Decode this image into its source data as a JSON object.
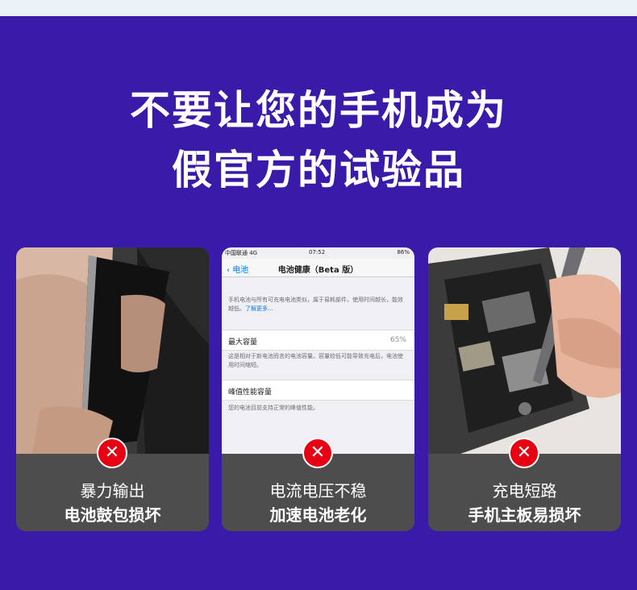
{
  "headline": {
    "line1": "不要让您的手机成为",
    "line2": "假官方的试验品"
  },
  "cards": [
    {
      "line1": "暴力输出",
      "line2": "电池鼓包损坏"
    },
    {
      "line1": "电流电压不稳",
      "line2": "加速电池老化"
    },
    {
      "line1": "充电短路",
      "line2": "手机主板易损坏"
    }
  ],
  "badge_symbol": "✕",
  "ios_screen": {
    "carrier": "中国联通 4G",
    "time": "07:52",
    "battery": "86%",
    "back_label": "电池",
    "nav_title": "电池健康（Beta 版）",
    "intro": "手机电池与所有可充电电池类似，属于易耗部件，使用时间越长，能效越低。",
    "learn_more": "了解更多...",
    "max_capacity_label": "最大容量",
    "max_capacity_value": "65%",
    "max_capacity_note": "这是相对于新电池而言的电池容量。容量较低可能导致充电后，电池使用时间缩短。",
    "peak_label": "峰值性能容量",
    "peak_note": "您的电池目前支持正常的峰值性能。"
  },
  "colors": {
    "background": "#3a1aa8",
    "caption_bg": "#4d4d4d",
    "badge": "#e60012"
  }
}
